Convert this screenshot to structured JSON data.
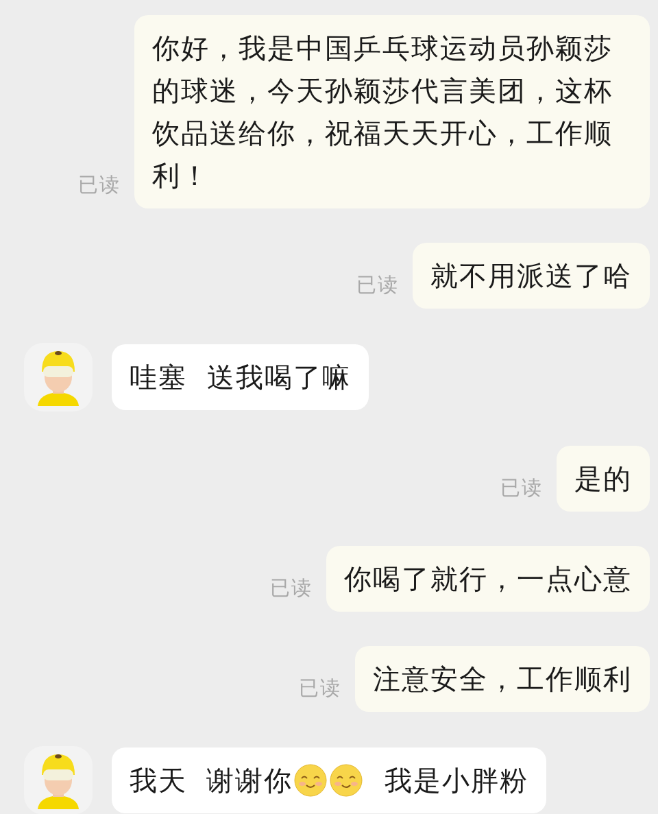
{
  "messages": [
    {
      "kind": "sent",
      "receipt": "已读",
      "parts": [
        {
          "kind": "text",
          "text": "你好，我是中国乒乓球运动员孙颖莎的球迷，今天孙颖莎代言美团，这杯饮品送给你，祝福天天开心，工作顺利！"
        }
      ]
    },
    {
      "kind": "sent",
      "receipt": "已读",
      "parts": [
        {
          "kind": "text",
          "text": "就不用派送了哈"
        }
      ]
    },
    {
      "kind": "received",
      "parts": [
        {
          "kind": "text",
          "text": "哇塞  送我喝了嘛"
        }
      ]
    },
    {
      "kind": "sent",
      "receipt": "已读",
      "parts": [
        {
          "kind": "text",
          "text": "是的"
        }
      ]
    },
    {
      "kind": "sent",
      "receipt": "已读",
      "parts": [
        {
          "kind": "text",
          "text": "你喝了就行，一点心意"
        }
      ]
    },
    {
      "kind": "sent",
      "receipt": "已读",
      "parts": [
        {
          "kind": "text",
          "text": "注意安全，工作顺利"
        }
      ]
    },
    {
      "kind": "received",
      "parts": [
        {
          "kind": "text",
          "text": "我天"
        },
        {
          "kind": "text",
          "text": "谢谢你"
        },
        {
          "kind": "emoji"
        },
        {
          "kind": "emoji"
        },
        {
          "kind": "text",
          "text": "我是小胖粉"
        }
      ]
    }
  ]
}
